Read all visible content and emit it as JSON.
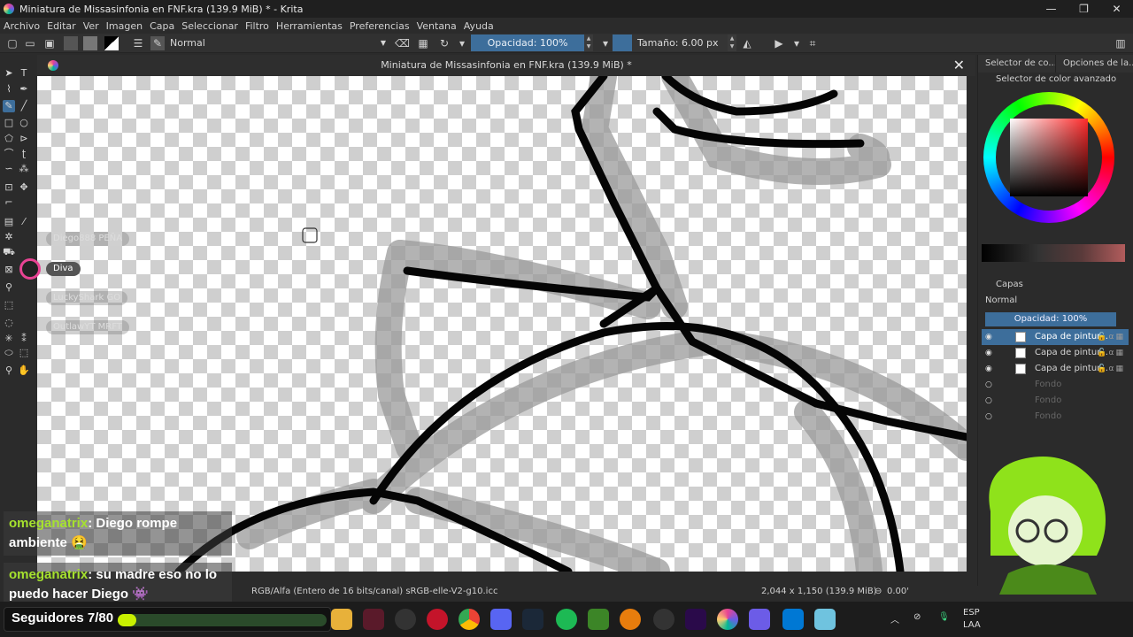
{
  "window": {
    "title": "Miniatura de Missasinfonia en FNF.kra (139.9 MiB) * - Krita",
    "min": "—",
    "max": "❐",
    "close": "✕"
  },
  "menu": [
    "Archivo",
    "Editar",
    "Ver",
    "Imagen",
    "Capa",
    "Seleccionar",
    "Filtro",
    "Herramientas",
    "Preferencias",
    "Ventana",
    "Ayuda"
  ],
  "toolbar": {
    "blend_mode": "Normal",
    "opacity": "Opacidad: 100%",
    "size": "Tamaño: 6.00 px"
  },
  "document": {
    "tab_title": "Miniatura de Missasinfonia en FNF.kra (139.9 MiB) *"
  },
  "status": {
    "color_space": "RGB/Alfa (Entero de 16 bits/canal)  sRGB-elle-V2-g10.icc",
    "dims": "2,044 x 1,150 (139.9 MiB)",
    "rotation": "0.00'"
  },
  "dock": {
    "tabs": [
      "Selector de co...",
      "Opciones de la..."
    ],
    "color_panel_title": "Selector de color avanzado",
    "layers_title": "Capas",
    "layers_blend": "Normal",
    "layers_opacity": "Opacidad:  100%",
    "layers": [
      {
        "name": "Capa de pintur...",
        "active": true,
        "visible": true
      },
      {
        "name": "Capa de pintur...",
        "active": false,
        "visible": true
      },
      {
        "name": "Capa de pintur...",
        "active": false,
        "visible": true
      },
      {
        "name": "Fondo",
        "active": false,
        "visible": false
      },
      {
        "name": "Fondo",
        "active": false,
        "visible": false
      },
      {
        "name": "Fondo",
        "active": false,
        "visible": false
      }
    ]
  },
  "overlay": {
    "viewers": [
      {
        "name": "Diego888",
        "tag": "PEÑA"
      },
      {
        "name": "Diva",
        "tag": ""
      },
      {
        "name": "LuckyShark",
        "tag": "GO"
      },
      {
        "name": "OutlawYT",
        "tag": "MRFT"
      }
    ],
    "chat": [
      {
        "user": "omeganatrix",
        "message": "Diego rompe ambiente 🤮"
      },
      {
        "user": "omeganatrix",
        "message": "su madre eso no lo puedo hacer Diego 👾"
      }
    ],
    "followers": {
      "label": "Seguidores 7/80",
      "progress": 0.09
    }
  },
  "taskbar": {
    "lang": "ESP",
    "layout": "LAA"
  },
  "colors": {
    "accent": "#3d6e9b",
    "chat_user": "#a6e22e",
    "follow_bar": "#c8f000"
  }
}
